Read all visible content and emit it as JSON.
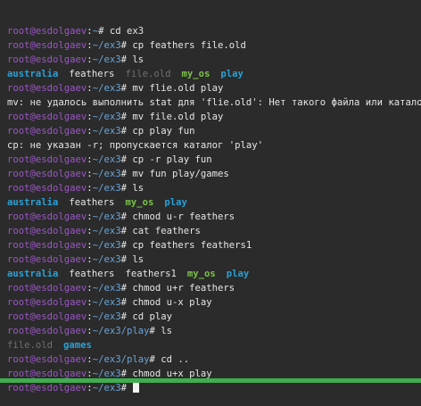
{
  "prompt": {
    "user": "root@esdolgaev",
    "sep": ":",
    "home_path": "~",
    "ex3_path": "~/ex3",
    "play_path": "~/ex3/play",
    "symbol": "#"
  },
  "lines": [
    {
      "type": "prompt",
      "path": "~",
      "cmd": " cd ex3"
    },
    {
      "type": "prompt",
      "path": "~/ex3",
      "cmd": " cp feathers file.old"
    },
    {
      "type": "prompt",
      "path": "~/ex3",
      "cmd": " ls"
    },
    {
      "type": "ls",
      "items": [
        {
          "name": "australia",
          "kind": "dir"
        },
        {
          "name": "feathers",
          "kind": "file"
        },
        {
          "name": "file.old",
          "kind": "muted"
        },
        {
          "name": "my_os",
          "kind": "direxec"
        },
        {
          "name": "play",
          "kind": "dir"
        }
      ]
    },
    {
      "type": "prompt",
      "path": "~/ex3",
      "cmd": " mv flie.old play"
    },
    {
      "type": "output",
      "text": "mv: не удалось выполнить stat для 'flie.old': Нет такого файла или каталога"
    },
    {
      "type": "prompt",
      "path": "~/ex3",
      "cmd": " mv file.old play"
    },
    {
      "type": "prompt",
      "path": "~/ex3",
      "cmd": " cp play fun"
    },
    {
      "type": "output",
      "text": "cp: не указан -r; пропускается каталог 'play'"
    },
    {
      "type": "prompt",
      "path": "~/ex3",
      "cmd": " cp -r play fun"
    },
    {
      "type": "prompt",
      "path": "~/ex3",
      "cmd": " mv fun play/games"
    },
    {
      "type": "prompt",
      "path": "~/ex3",
      "cmd": " ls"
    },
    {
      "type": "ls",
      "items": [
        {
          "name": "australia",
          "kind": "dir"
        },
        {
          "name": "feathers",
          "kind": "file"
        },
        {
          "name": "my_os",
          "kind": "direxec"
        },
        {
          "name": "play",
          "kind": "dir"
        }
      ]
    },
    {
      "type": "prompt",
      "path": "~/ex3",
      "cmd": " chmod u-r feathers"
    },
    {
      "type": "prompt",
      "path": "~/ex3",
      "cmd": " cat feathers"
    },
    {
      "type": "prompt",
      "path": "~/ex3",
      "cmd": " cp feathers feathers1"
    },
    {
      "type": "prompt",
      "path": "~/ex3",
      "cmd": " ls"
    },
    {
      "type": "ls",
      "items": [
        {
          "name": "australia",
          "kind": "dir"
        },
        {
          "name": "feathers",
          "kind": "file"
        },
        {
          "name": "feathers1",
          "kind": "file"
        },
        {
          "name": "my_os",
          "kind": "direxec"
        },
        {
          "name": "play",
          "kind": "dir"
        }
      ]
    },
    {
      "type": "prompt",
      "path": "~/ex3",
      "cmd": " chmod u+r feathers"
    },
    {
      "type": "prompt",
      "path": "~/ex3",
      "cmd": " chmod u-x play"
    },
    {
      "type": "prompt",
      "path": "~/ex3",
      "cmd": " cd play"
    },
    {
      "type": "prompt",
      "path": "~/ex3/play",
      "cmd": " ls"
    },
    {
      "type": "ls",
      "items": [
        {
          "name": "file.old",
          "kind": "muted"
        },
        {
          "name": "games",
          "kind": "dir"
        }
      ]
    },
    {
      "type": "prompt",
      "path": "~/ex3/play",
      "cmd": " cd .."
    },
    {
      "type": "prompt",
      "path": "~/ex3",
      "cmd": " chmod u+x play"
    },
    {
      "type": "prompt",
      "path": "~/ex3",
      "cmd": " ",
      "cursor": true
    }
  ],
  "colors": {
    "background": "#2b2b2b",
    "user": "#9a57c4",
    "path": "#6aa3d6",
    "dir": "#2aa1d6",
    "direxec": "#7cc44a",
    "muted": "#6f6f6f",
    "statusbar": "#3fae4e"
  }
}
